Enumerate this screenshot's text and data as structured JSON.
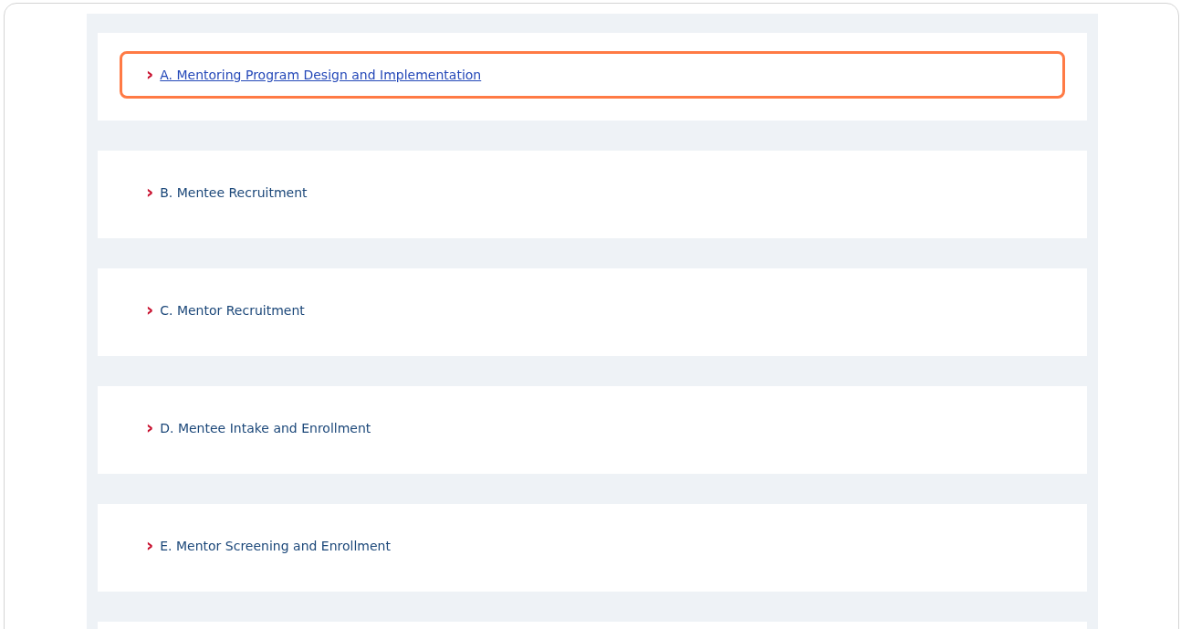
{
  "accordion": {
    "items": [
      {
        "chevron": "›",
        "title": "A. Mentoring Program Design and Implementation",
        "highlighted": true
      },
      {
        "chevron": "›",
        "title": "B. Mentee Recruitment",
        "highlighted": false
      },
      {
        "chevron": "›",
        "title": "C. Mentor Recruitment",
        "highlighted": false
      },
      {
        "chevron": "›",
        "title": "D. Mentee Intake and Enrollment",
        "highlighted": false
      },
      {
        "chevron": "›",
        "title": "E. Mentor Screening and Enrollment",
        "highlighted": false
      }
    ]
  }
}
